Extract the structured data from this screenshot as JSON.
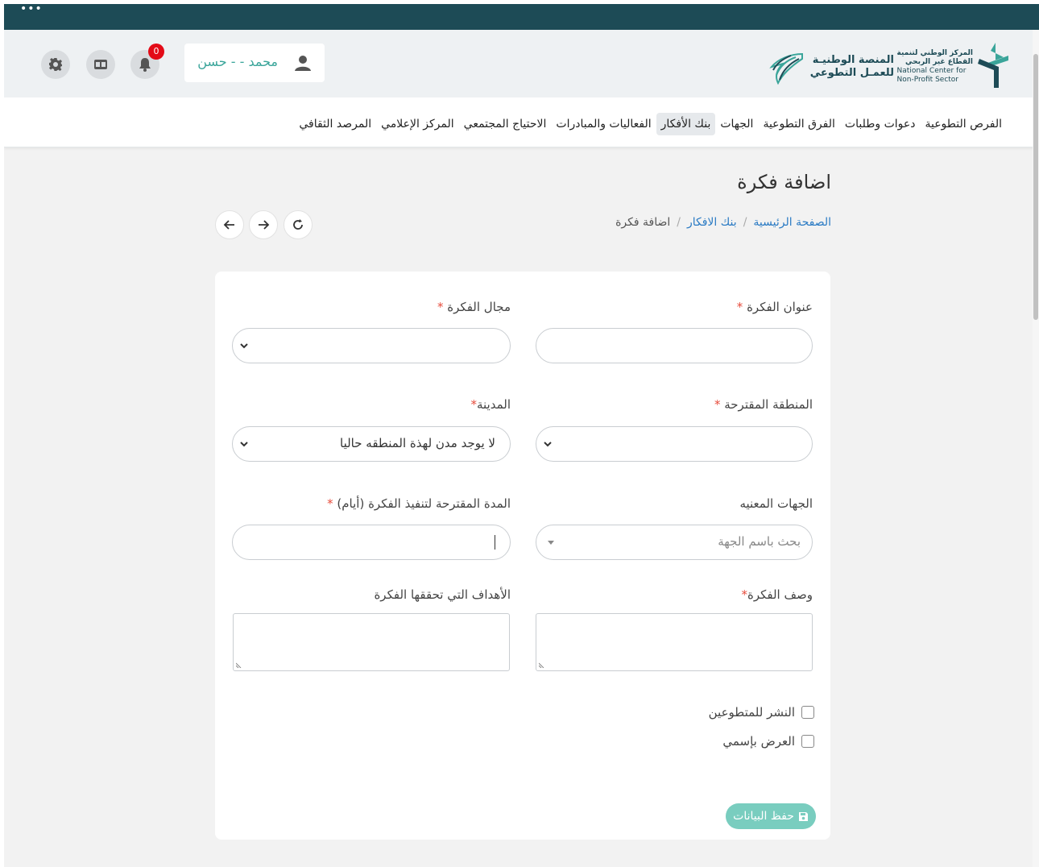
{
  "header": {
    "ncnp_logo_ar_line1": "المركز الوطني لتنمية",
    "ncnp_logo_ar_line2": "القطاع غير الربحي",
    "ncnp_logo_en_line1": "National Center for",
    "ncnp_logo_en_line2": "Non-Profit Sector",
    "platform_logo_line1": "المنصة الوطنيـة",
    "platform_logo_line2": "للعمـل التطوعي",
    "user_name": "محمد - - حسن",
    "notification_count": "0",
    "icons": [
      "user-icon",
      "bell-icon",
      "id-card-icon",
      "gear-icon"
    ]
  },
  "nav": {
    "items": [
      {
        "label": "الفرص التطوعية",
        "active": false
      },
      {
        "label": "دعوات وطلبات",
        "active": false
      },
      {
        "label": "الفرق التطوعية",
        "active": false
      },
      {
        "label": "الجهات",
        "active": false
      },
      {
        "label": "بنك الأفكار",
        "active": true
      },
      {
        "label": "الفعاليات والمبادرات",
        "active": false
      },
      {
        "label": "الاحتياج المجتمعي",
        "active": false
      },
      {
        "label": "المركز الإعلامي",
        "active": false
      },
      {
        "label": "المرصد الثقافي",
        "active": false
      }
    ]
  },
  "page": {
    "title": "اضافة فكرة",
    "breadcrumb": {
      "home": "الصفحة الرئيسية",
      "section": "بنك الافكار",
      "current": "اضافة فكرة",
      "separator": "/"
    }
  },
  "form": {
    "idea_title_label": "عنوان الفكرة",
    "idea_title_value": "",
    "idea_field_label": "مجال الفكرة",
    "idea_field_value": "",
    "region_label": "المنطقة المقترحة",
    "region_value": "",
    "city_label": "المدينة",
    "city_value": "لا يوجد مدن لهذة المنطقه حاليا",
    "entities_label": "الجهات المعنيه",
    "entities_placeholder": "بحث باسم الجهة",
    "duration_label": "المدة المقترحة لتنفيذ الفكرة (أيام)",
    "duration_value": "",
    "description_label": "وصف الفكرة",
    "goals_label": "الأهداف التي تحققها الفكرة",
    "publish_volunteers_label": "النشر للمتطوعين",
    "publish_volunteers_checked": false,
    "show_name_label": "العرض بإسمي",
    "show_name_checked": false,
    "required_mark": "*",
    "save_button_label": "حفظ البيانات"
  },
  "colors": {
    "topbar": "#1d4b56",
    "accent_teal": "#3aa59a",
    "save_button": "#79cdbf",
    "link_blue": "#2b7bc4",
    "required_red": "#e74c3c",
    "badge_red": "#e30b17"
  }
}
